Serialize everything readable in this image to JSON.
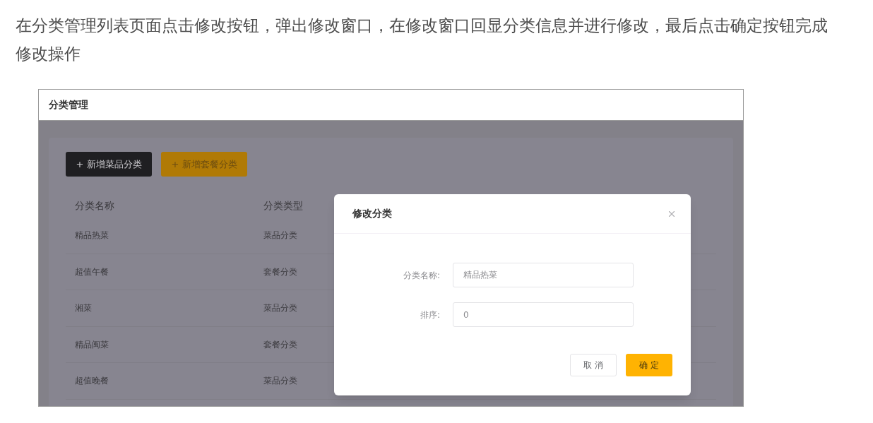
{
  "article": {
    "paragraph": "在分类管理列表页面点击修改按钮，弹出修改窗口，在修改窗口回显分类信息并进行修改，最后点击确定按钮完成修改操作"
  },
  "page": {
    "title": "分类管理",
    "buttons": [
      {
        "label": "+ 新增菜品分类",
        "kind": "dark"
      },
      {
        "label": "+ 新增套餐分类",
        "kind": "primary"
      }
    ]
  },
  "table": {
    "columns": [
      "分类名称",
      "分类类型"
    ],
    "rows": [
      [
        "精品热菜",
        "菜品分类"
      ],
      [
        "超值午餐",
        "套餐分类"
      ],
      [
        "湘菜",
        "菜品分类"
      ],
      [
        "精品闽菜",
        "套餐分类"
      ],
      [
        "超值晚餐",
        "菜品分类"
      ]
    ]
  },
  "dialog": {
    "title": "修改分类",
    "fields": [
      {
        "label": "分类名称:",
        "value": "精品热菜"
      },
      {
        "label": "排序:",
        "value": "0"
      }
    ],
    "buttons": [
      {
        "label": "取 消",
        "kind": "secondary"
      },
      {
        "label": "确 定",
        "kind": "primary"
      }
    ]
  }
}
